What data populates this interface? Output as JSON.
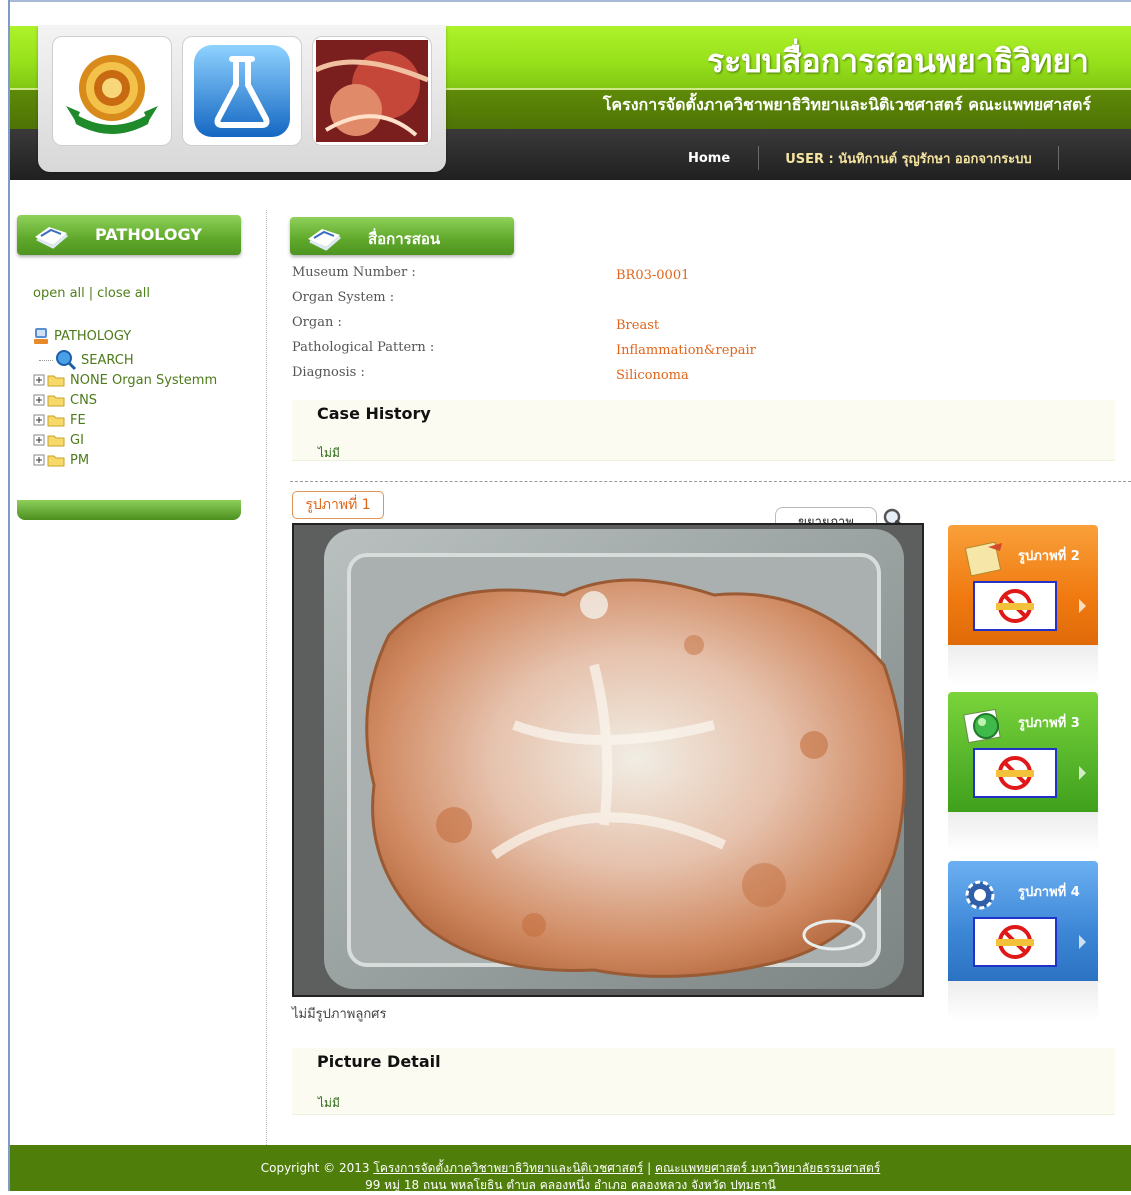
{
  "header": {
    "title": "ระบบสื่อการสอนพยาธิวิทยา",
    "subtitle": "โครงการจัดตั้งภาควิชาพยาธิวิทยาและนิติเวชศาสตร์ คณะแพทยศาสตร์",
    "nav_home": "Home",
    "nav_user": "USER : นันทิกานต์ รุญรักษา ออกจากระบบ"
  },
  "sidebar": {
    "title": "PATHOLOGY",
    "open_all": "open all",
    "separator": "|",
    "close_all": "close all",
    "tree": [
      {
        "label": "PATHOLOGY",
        "icon": "root-icon"
      },
      {
        "label": "SEARCH",
        "icon": "search-icon"
      },
      {
        "label": "NONE Organ Systemm",
        "icon": "folder-icon"
      },
      {
        "label": "CNS",
        "icon": "folder-icon"
      },
      {
        "label": "FE",
        "icon": "folder-icon"
      },
      {
        "label": "GI",
        "icon": "folder-icon"
      },
      {
        "label": "PM",
        "icon": "folder-icon"
      }
    ]
  },
  "main": {
    "title": "สื่อการสอน",
    "fields": {
      "museum_number_label": "Museum Number :",
      "museum_number_value": "BR03-0001",
      "organ_system_label": "Organ System :",
      "organ_system_value": "",
      "organ_label": "Organ :",
      "organ_value": "Breast",
      "pattern_label": "Pathological Pattern :",
      "pattern_value": "Inflammation&repair",
      "diagnosis_label": "Diagnosis :",
      "diagnosis_value": "Siliconoma"
    },
    "case_history_title": "Case History",
    "case_history_body": "ไม่มี",
    "image_tab": "รูปภาพที่ 1",
    "zoom_label": "ขยายภาพ",
    "caption": "ไม่มีรูปภาพลูกศร",
    "picture_detail_title": "Picture Detail",
    "picture_detail_body": "ไม่มี",
    "thumbs": [
      {
        "label": "รูปภาพที่ 2",
        "color": "#f07a10",
        "placeholder": "NO PICTURE"
      },
      {
        "label": "รูปภาพที่ 3",
        "color": "#55b42a",
        "placeholder": "NO PICTURE"
      },
      {
        "label": "รูปภาพที่ 4",
        "color": "#3c86d6",
        "placeholder": "NO PICTURE"
      }
    ]
  },
  "footer": {
    "copyright": "Copyright © 2013",
    "link1": "โครงการจัดตั้งภาควิชาพยาธิวิทยาและนิติเวชศาสตร์",
    "separator": "|",
    "link2": "คณะแพทยศาสตร์ มหาวิทยาลัยธรรมศาสตร์",
    "address": "99 หมู่ 18 ถนน พหลโยธิน ตำบล คลองหนึ่ง อำเภอ คลองหลวง จังหวัด ปทุมธานี"
  },
  "colors": {
    "header_green": "#98e21c",
    "header_olive": "#4c7205",
    "nav_dark": "#202020",
    "accent_orange": "#e0651c",
    "sidebar_green": "#5fa82a",
    "footer_green": "#4f7f0a"
  }
}
